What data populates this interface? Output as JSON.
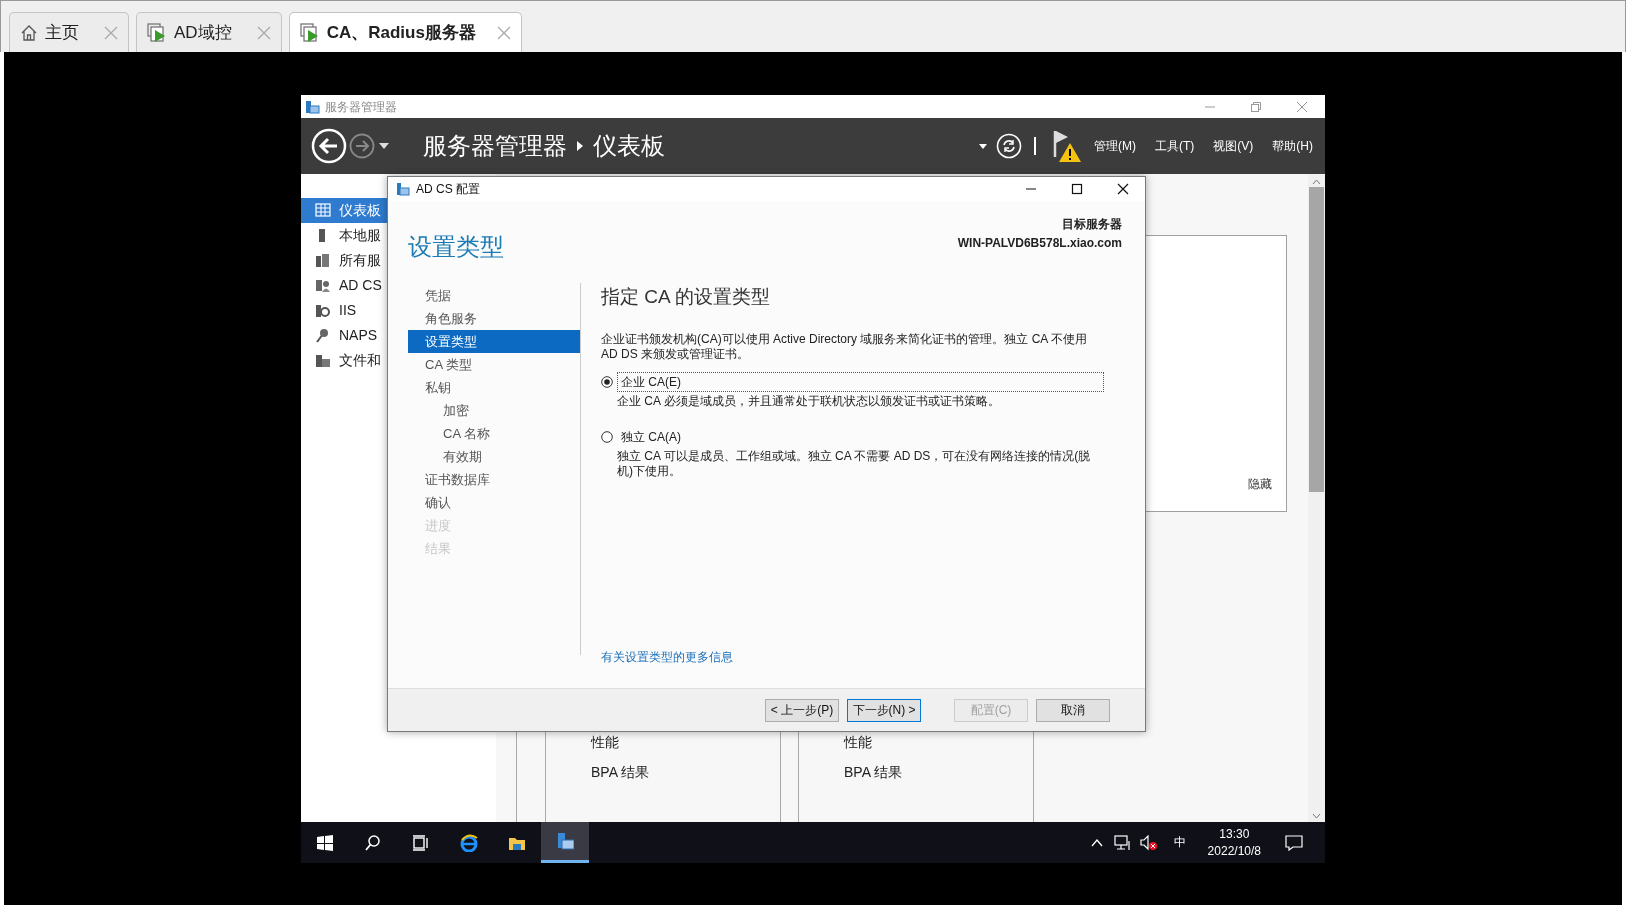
{
  "browser_tabs": [
    {
      "label": "主页",
      "selected": false
    },
    {
      "label": "AD域控",
      "selected": false
    },
    {
      "label": "CA、Radius服务器",
      "selected": true
    }
  ],
  "server_manager": {
    "window": {
      "title": "服务器管理器"
    },
    "header": {
      "breadcrumb": [
        "服务器管理器",
        "仪表板"
      ],
      "menus": [
        "管理(M)",
        "工具(T)",
        "视图(V)",
        "帮助(H)"
      ]
    },
    "sidebar": {
      "items": [
        {
          "label": "仪表板",
          "selected": true
        },
        {
          "label": "本地服",
          "selected": false
        },
        {
          "label": "所有服",
          "selected": false
        },
        {
          "label": "AD CS",
          "selected": false
        },
        {
          "label": "IIS",
          "selected": false
        },
        {
          "label": "NAPS",
          "selected": false
        },
        {
          "label": "文件和",
          "selected": false
        }
      ]
    },
    "welcome_panel": {
      "hide_link": "隐藏"
    },
    "tiles": [
      {
        "rows": [
          "性能",
          "BPA 结果"
        ]
      },
      {
        "rows": [
          "性能",
          "BPA 结果"
        ]
      }
    ]
  },
  "dialog": {
    "title": "AD CS 配置",
    "heading": "设置类型",
    "target_label": "目标服务器",
    "target_server": "WIN-PALVD6B578L.xiao.com",
    "steps": [
      {
        "label": "凭据",
        "selected": false,
        "disabled": false
      },
      {
        "label": "角色服务",
        "selected": false,
        "disabled": false
      },
      {
        "label": "设置类型",
        "selected": true,
        "disabled": false
      },
      {
        "label": "CA 类型",
        "selected": false,
        "disabled": false
      },
      {
        "label": "私钥",
        "selected": false,
        "disabled": false,
        "children": [
          {
            "label": "加密",
            "selected": false,
            "disabled": false
          },
          {
            "label": "CA 名称",
            "selected": false,
            "disabled": false
          },
          {
            "label": "有效期",
            "selected": false,
            "disabled": false
          }
        ]
      },
      {
        "label": "证书数据库",
        "selected": false,
        "disabled": false
      },
      {
        "label": "确认",
        "selected": false,
        "disabled": false
      },
      {
        "label": "进度",
        "selected": false,
        "disabled": true
      },
      {
        "label": "结果",
        "selected": false,
        "disabled": true
      }
    ],
    "section_title": "指定 CA 的设置类型",
    "description": "企业证书颁发机构(CA)可以使用 Active Directory 域服务来简化证书的管理。独立 CA 不使用 AD DS 来颁发或管理证书。",
    "options": [
      {
        "label": "企业 CA(E)",
        "description": "企业 CA 必须是域成员，并且通常处于联机状态以颁发证书或证书策略。",
        "selected": true
      },
      {
        "label": "独立 CA(A)",
        "description": "独立 CA 可以是成员、工作组或域。独立 CA 不需要 AD DS，可在没有网络连接的情况(脱机)下使用。",
        "selected": false
      }
    ],
    "more_info_link": "有关设置类型的更多信息",
    "buttons": [
      {
        "label": "< 上一步(P)",
        "disabled": false,
        "default": false
      },
      {
        "label": "下一步(N) >",
        "disabled": false,
        "default": true
      },
      {
        "label": "配置(C)",
        "disabled": true,
        "default": false
      },
      {
        "label": "取消",
        "disabled": false,
        "default": false
      }
    ]
  },
  "taskbar": {
    "ime": "中",
    "time": "13:30",
    "date": "2022/10/8"
  }
}
